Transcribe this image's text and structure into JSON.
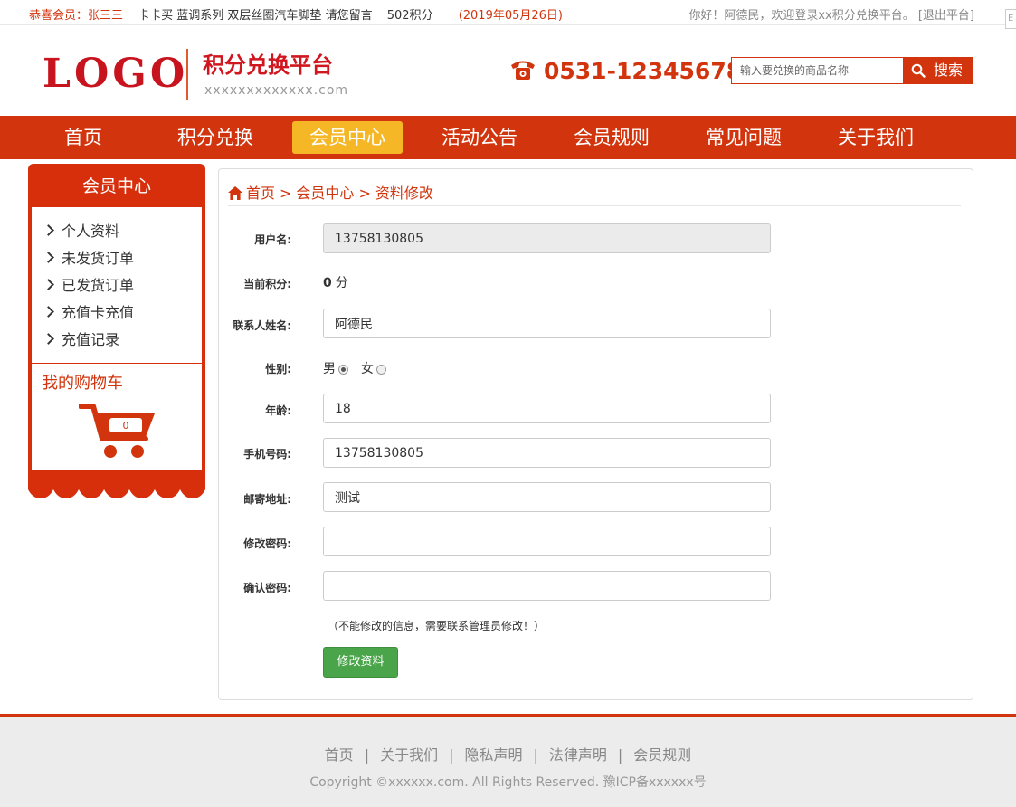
{
  "topbar": {
    "congrats_label": "恭喜会员：",
    "congrats_name": "张三三",
    "marquee_text": "卡卡买 蓝调系列 双层丝圈汽车脚垫 请您留言",
    "marquee_points": "502积分",
    "marquee_date": "(2019年05月26日)",
    "welcome": "你好！阿德民，欢迎登录xx积分兑换平台。",
    "logout": "[退出平台]",
    "corner_glyph": "E"
  },
  "header": {
    "logo": "LOGO",
    "site_title": "积分兑换平台",
    "site_subtitle": "xxxxxxxxxxxxx.com",
    "phone": "0531-12345678",
    "search_placeholder": "输入要兑换的商品名称",
    "search_button": "搜索"
  },
  "nav": {
    "items": [
      "首页",
      "积分兑换",
      "会员中心",
      "活动公告",
      "会员规则",
      "常见问题",
      "关于我们"
    ],
    "active_index": 2
  },
  "sidebar": {
    "title": "会员中心",
    "items": [
      "个人资料",
      "未发货订单",
      "已发货订单",
      "充值卡充值",
      "充值记录"
    ],
    "cart_title": "我的购物车",
    "cart_count": "0"
  },
  "breadcrumb": {
    "items": [
      "首页",
      "会员中心",
      "资料修改"
    ],
    "separator": ">"
  },
  "form": {
    "username_label": "用户名:",
    "username_value": "13758130805",
    "points_label": "当前积分:",
    "points_value": "0",
    "points_unit": "分",
    "contact_label": "联系人姓名:",
    "contact_value": "阿德民",
    "gender_label": "性别:",
    "gender_male": "男",
    "gender_female": "女",
    "age_label": "年龄:",
    "age_value": "18",
    "mobile_label": "手机号码:",
    "mobile_value": "13758130805",
    "address_label": "邮寄地址:",
    "address_value": "测试",
    "new_password_label": "修改密码:",
    "confirm_password_label": "确认密码:",
    "note": "（不能修改的信息，需要联系管理员修改！）",
    "submit": "修改资料"
  },
  "footer": {
    "links": [
      "首页",
      "关于我们",
      "隐私声明",
      "法律声明",
      "会员规则"
    ],
    "copyright": "Copyright ©xxxxxx.com. All Rights Reserved. 豫ICP备xxxxxx号"
  },
  "colors": {
    "brand_red": "#d2350e",
    "nav_active": "#f6b727",
    "submit_green": "#4aa54a"
  }
}
